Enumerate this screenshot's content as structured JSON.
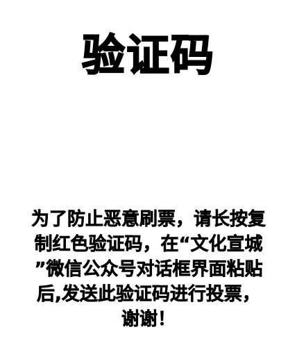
{
  "page": {
    "title": "验证码",
    "message_lines": [
      "为了防止恶意刷票，请长按复",
      "制红色验证码，在“文化宣城",
      "”微信公众号对话框界面粘贴",
      "后,发送此验证码进行投票，",
      "谢谢！"
    ]
  },
  "colors": {
    "background": "#ffffff",
    "text": "#000000"
  }
}
